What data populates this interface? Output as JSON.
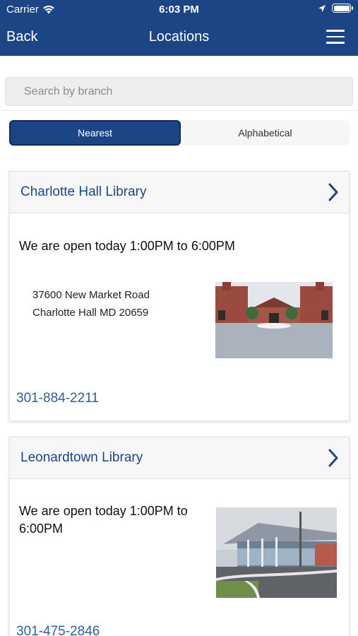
{
  "status_bar": {
    "carrier": "Carrier",
    "time": "6:03 PM"
  },
  "nav": {
    "back_label": "Back",
    "title": "Locations"
  },
  "search": {
    "placeholder": "Search by branch"
  },
  "segments": {
    "nearest": "Nearest",
    "alphabetical": "Alphabetical",
    "selected": "Nearest"
  },
  "locations": [
    {
      "name": "Charlotte Hall Library",
      "hours": "We are open today 1:00PM to 6:00PM",
      "address_line1": "37600 New Market Road",
      "address_line2": "Charlotte Hall MD 20659",
      "phone": "301-884-2211"
    },
    {
      "name": "Leonardtown Library",
      "hours_line1": "We are open today 1:00PM to",
      "hours_line2": "6:00PM",
      "phone": "301-475-2846"
    }
  ],
  "colors": {
    "brand": "#1c4586",
    "link": "#2f5f9e"
  }
}
